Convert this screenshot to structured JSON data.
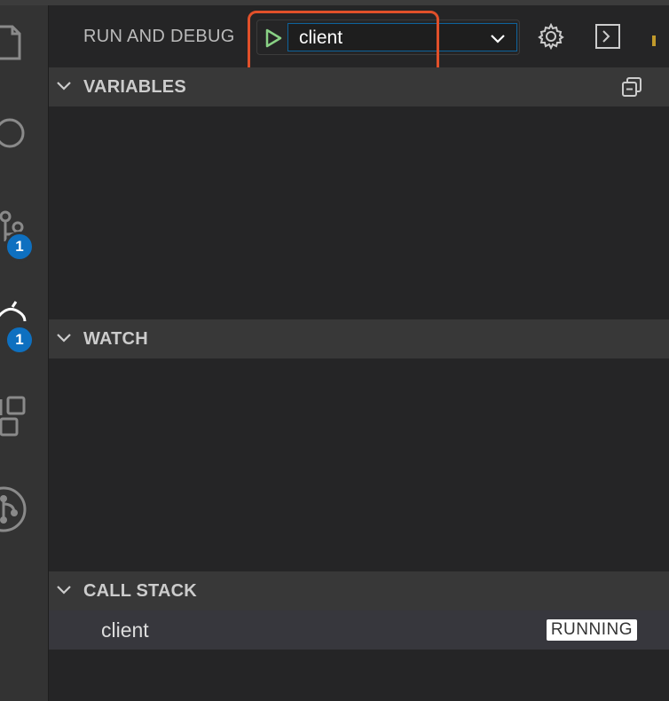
{
  "header": {
    "title": "RUN AND DEBUG",
    "config_selected": "client",
    "play_icon": "play-icon",
    "settings_icon": "gear-icon",
    "terminal_icon": "terminal-icon"
  },
  "sections": {
    "variables": {
      "title": "VARIABLES"
    },
    "watch": {
      "title": "WATCH"
    },
    "call_stack": {
      "title": "CALL STACK",
      "items": [
        {
          "label": "client",
          "status": "RUNNING"
        }
      ]
    }
  },
  "activity_bar": {
    "items": [
      {
        "icon": "explorer-icon"
      },
      {
        "icon": "search-icon"
      },
      {
        "icon": "source-control-icon",
        "badge": "1"
      },
      {
        "icon": "run-debug-icon",
        "badge": "1"
      },
      {
        "icon": "extensions-icon"
      },
      {
        "icon": "remote-icon"
      }
    ]
  },
  "colors": {
    "accent": "#0e70c0",
    "highlight": "#e1502a",
    "play": "#89d185"
  }
}
